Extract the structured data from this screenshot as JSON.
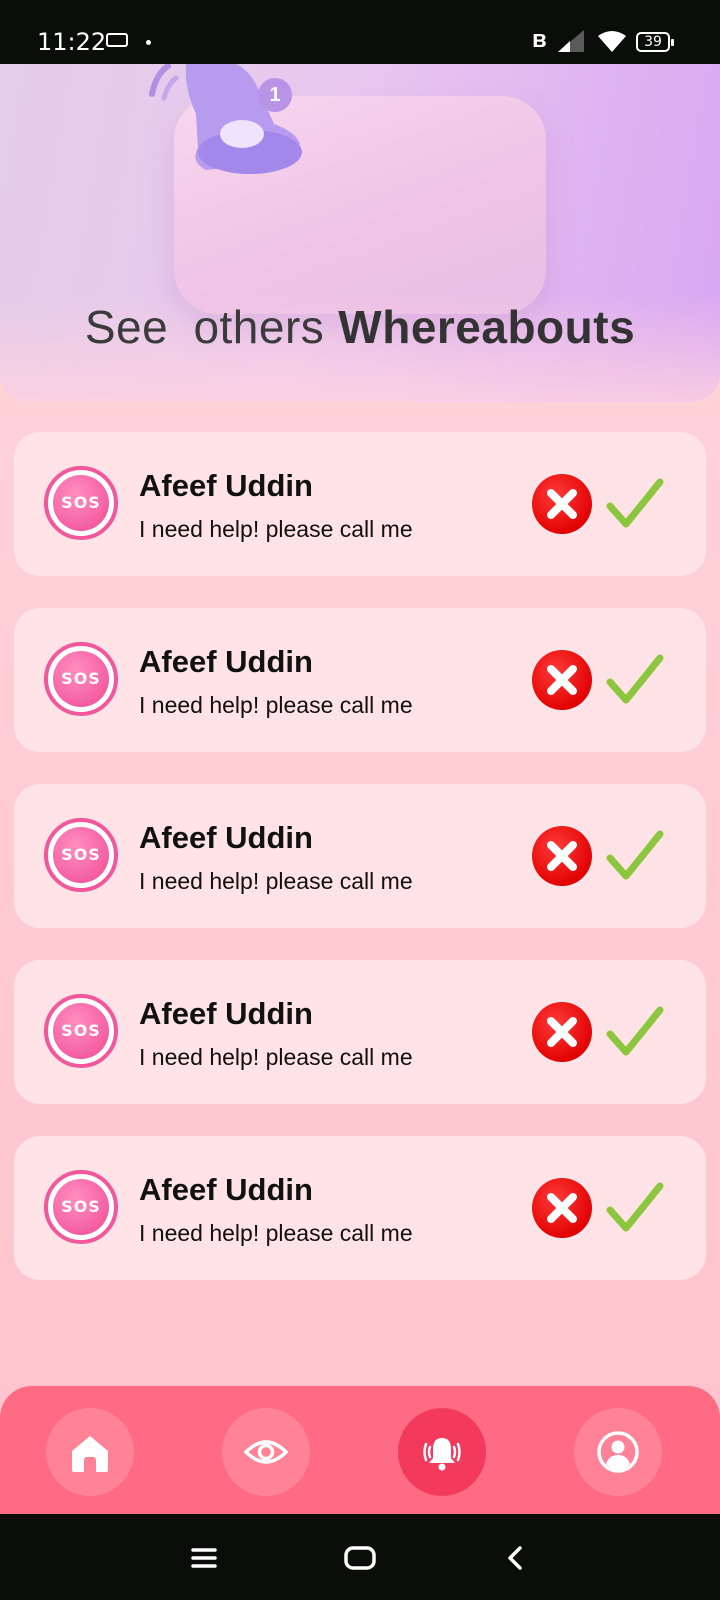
{
  "status_bar": {
    "time": "11:22",
    "battery": "39",
    "icons": [
      "bus-icon",
      "bluetooth-icon",
      "signal-icon",
      "wifi-icon",
      "battery-icon"
    ]
  },
  "hero": {
    "title_light": "See others",
    "title_bold": "Whereabouts",
    "badge_count": "1",
    "illustration": "notification-bell-icon"
  },
  "alerts": [
    {
      "badge": "SOS",
      "name": "Afeef Uddin",
      "message": "I need help! please call me"
    },
    {
      "badge": "SOS",
      "name": "Afeef Uddin",
      "message": "I need help! please call me"
    },
    {
      "badge": "SOS",
      "name": "Afeef Uddin",
      "message": "I need help! please call me"
    },
    {
      "badge": "SOS",
      "name": "Afeef Uddin",
      "message": "I need help! please call me"
    },
    {
      "badge": "SOS",
      "name": "Afeef Uddin",
      "message": "I need help! please call me"
    }
  ],
  "bottom_nav": {
    "items": [
      {
        "icon": "home-icon",
        "active": false
      },
      {
        "icon": "eye-icon",
        "active": false
      },
      {
        "icon": "alarm-bell-icon",
        "active": true
      },
      {
        "icon": "profile-icon",
        "active": false
      }
    ]
  },
  "system_nav": [
    "menu-icon",
    "home-square-icon",
    "back-icon"
  ],
  "colors": {
    "background": "#ffd0d8",
    "card": "#ffe3e6",
    "accent": "#ff6b82",
    "active_nav": "#f33a5d",
    "decline": "#e00000",
    "accept": "#8cc63f",
    "sos": "#f45ea3"
  }
}
